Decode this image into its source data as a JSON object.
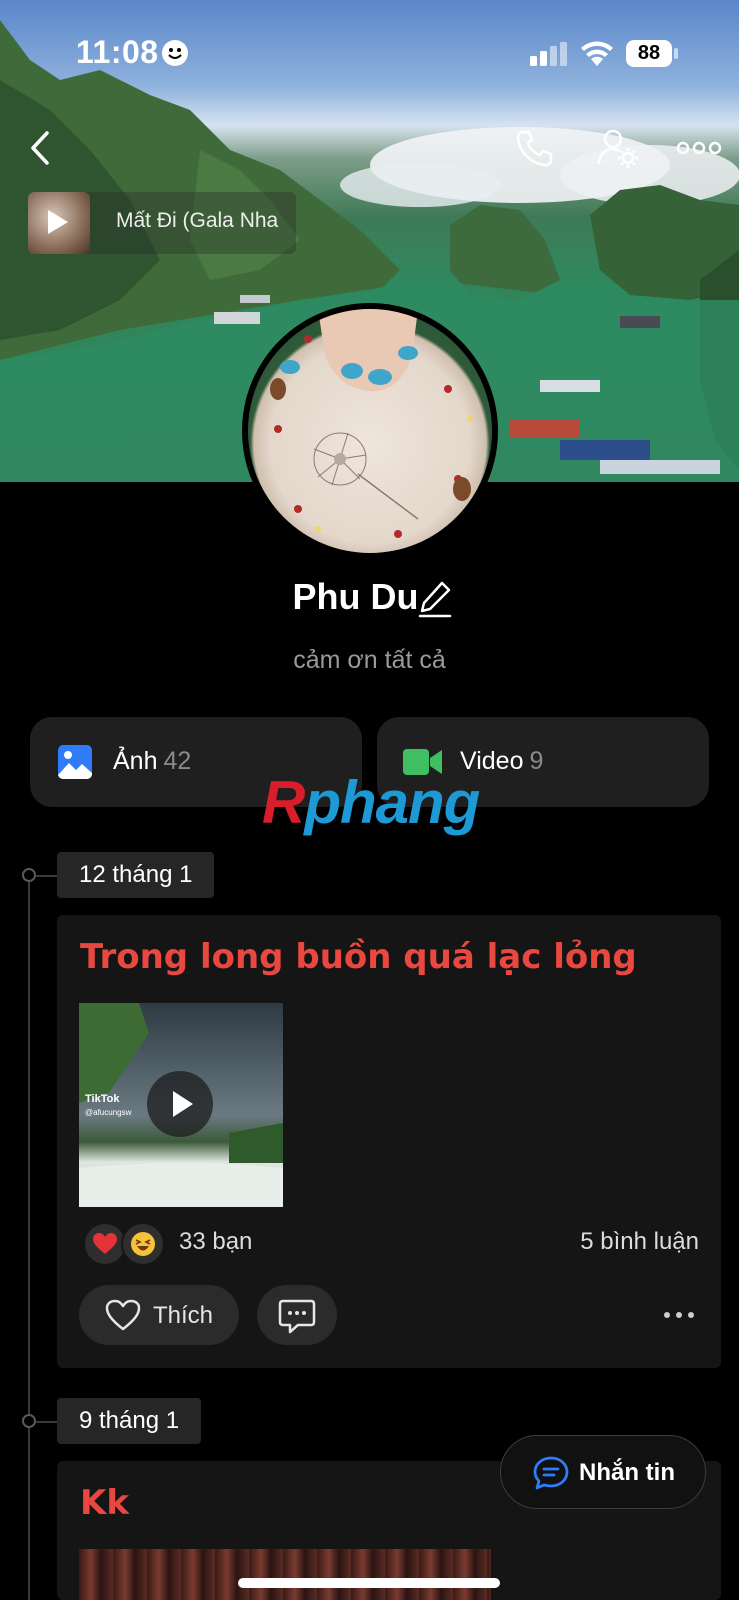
{
  "status_bar": {
    "time": "11:08",
    "battery": "88"
  },
  "music": {
    "title": "Mất Đi (Gala Nha"
  },
  "profile": {
    "name": "Phu Du",
    "bio": "cảm ơn tất cả"
  },
  "media": {
    "photos": {
      "label": "Ảnh",
      "count": "42"
    },
    "videos": {
      "label": "Video",
      "count": "9"
    }
  },
  "watermark": {
    "first": "R",
    "rest": "phang"
  },
  "timeline": [
    {
      "date": "12 tháng 1",
      "title": "Trong long buồn quá lạc lỏng",
      "video_overlay": {
        "brand": "TikTok",
        "handle": "@afucungsw"
      },
      "reactions": "33 bạn",
      "comments": "5 bình luận",
      "like_label": "Thích"
    },
    {
      "date": "9 tháng 1",
      "title": "Kk"
    }
  ],
  "message_button": {
    "label": "Nhắn tin"
  },
  "colors": {
    "accent_blue": "#2f7cf6",
    "video_green": "#3fbf62",
    "post_title_red": "#e8483f"
  }
}
